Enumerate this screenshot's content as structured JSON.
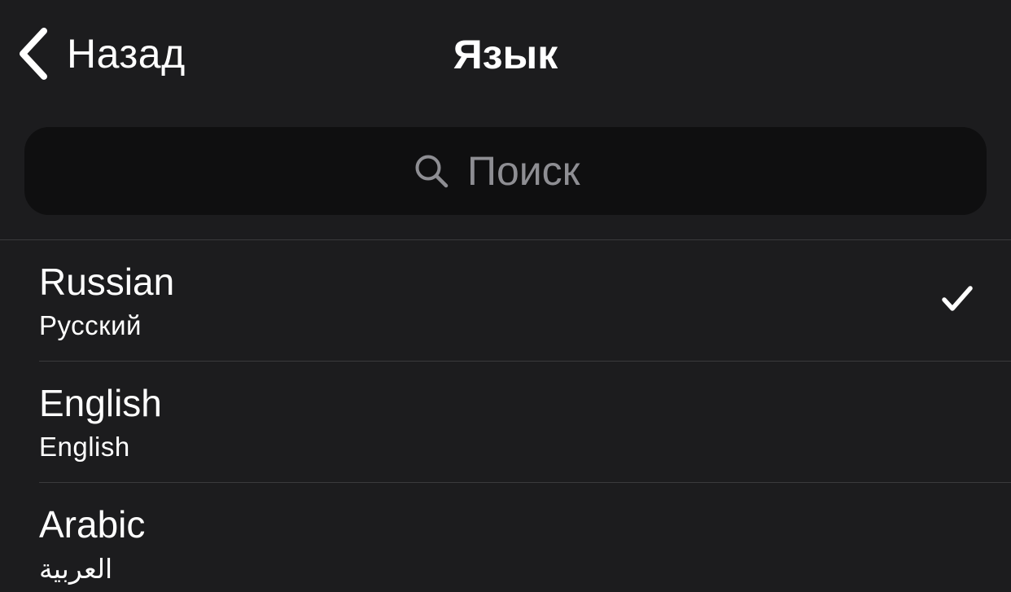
{
  "nav": {
    "back_label": "Назад",
    "title": "Язык"
  },
  "search": {
    "placeholder": "Поиск",
    "value": ""
  },
  "languages": [
    {
      "name": "Russian",
      "native": "Русский",
      "selected": true
    },
    {
      "name": "English",
      "native": "English",
      "selected": false
    },
    {
      "name": "Arabic",
      "native": "العربية",
      "selected": false
    }
  ],
  "icons": {
    "back": "chevron-left-icon",
    "search": "search-icon",
    "selected": "checkmark-icon"
  },
  "colors": {
    "background": "#1c1c1e",
    "search_field": "#0f0f10",
    "separator": "#3a3a3c",
    "placeholder": "#8e8e93",
    "text": "#ffffff"
  }
}
